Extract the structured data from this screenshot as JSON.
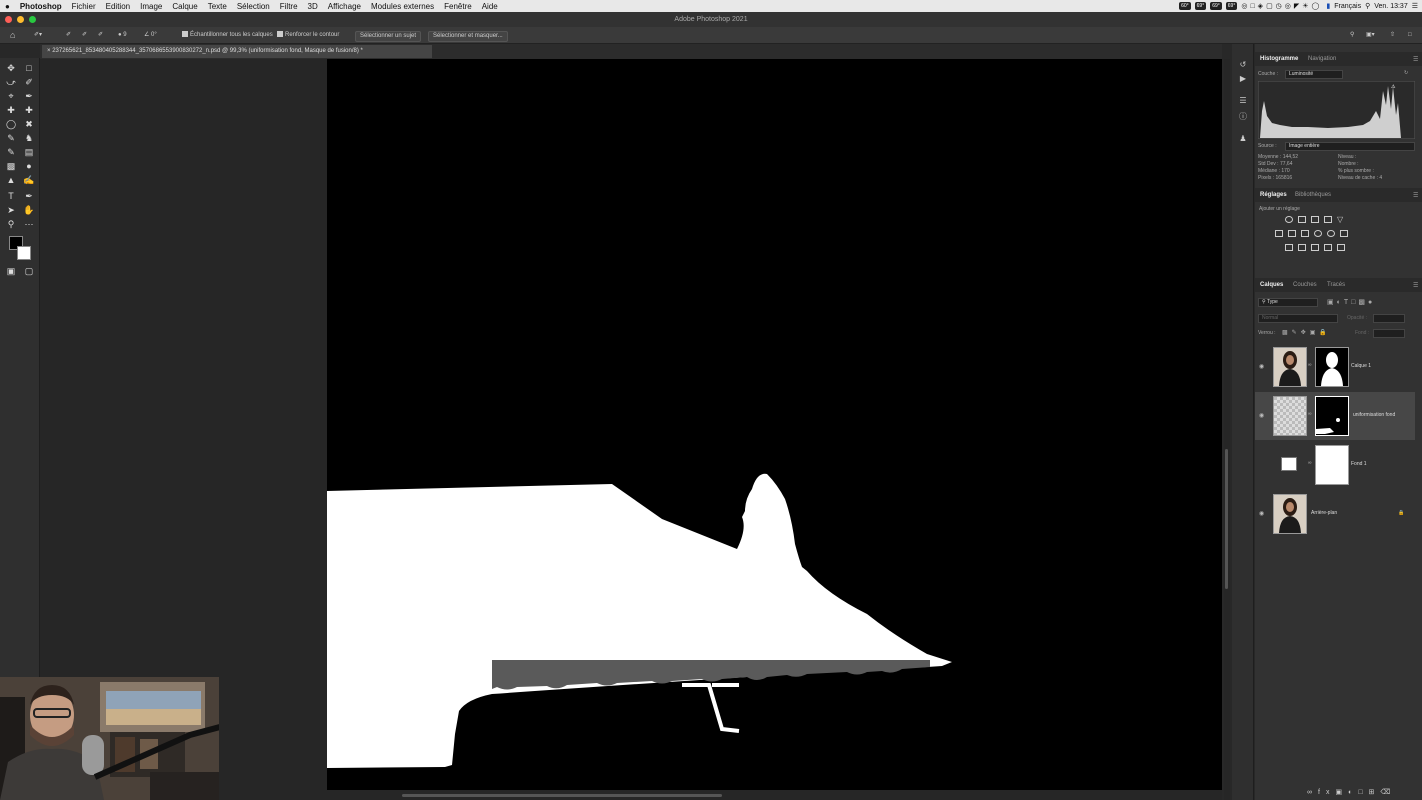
{
  "menubar": {
    "apple": "",
    "items": [
      "Photoshop",
      "Fichier",
      "Edition",
      "Image",
      "Calque",
      "Texte",
      "Sélection",
      "Filtre",
      "3D",
      "Affichage",
      "Modules externes",
      "Fenêtre",
      "Aide"
    ],
    "tray": [
      "60°",
      "69°",
      "69°",
      "69°"
    ],
    "language": "Français",
    "clock": "Ven. 13:37"
  },
  "window": {
    "title": "Adobe Photoshop 2021"
  },
  "options": {
    "brush_size": "9",
    "angle": "0°",
    "sample_all_layers": "Échantillonner tous les calques",
    "enhance_edge": "Renforcer le contour",
    "select_subject": "Sélectionner un sujet",
    "select_and_mask": "Sélectionner et masquer..."
  },
  "document": {
    "tab_close": "×",
    "tab_label": "237265621_853480405288344_3570686553900830272_n.psd @ 99,3% (uniformisation fond, Masque de fusion/8) *"
  },
  "histogram_panel": {
    "tabs": [
      "Histogramme",
      "Navigation"
    ],
    "channel_label": "Couche :",
    "channel_value": "Luminosité",
    "source_label": "Source :",
    "source_value": "Image entière",
    "stats_left": [
      {
        "label": "Moyenne :",
        "value": "144,52"
      },
      {
        "label": "Std Dev :",
        "value": "77,64"
      },
      {
        "label": "Médiane :",
        "value": "170"
      },
      {
        "label": "Pixels :",
        "value": "165816"
      }
    ],
    "stats_right": [
      {
        "label": "Niveau :",
        "value": ""
      },
      {
        "label": "Nombre :",
        "value": ""
      },
      {
        "label": "% plus sombre :",
        "value": ""
      },
      {
        "label": "Niveau de cache :",
        "value": "4"
      }
    ]
  },
  "adjustments_panel": {
    "tabs": [
      "Réglages",
      "Bibliothèques"
    ],
    "hint": "Ajouter un réglage"
  },
  "layers_panel": {
    "tabs": [
      "Calques",
      "Couches",
      "Tracés"
    ],
    "filter_value": "Type",
    "blend_mode": "Normal",
    "opacity_label": "Opacité :",
    "lock_label": "Verrou :",
    "fill_label": "Fond :",
    "layers": [
      {
        "name": "Calque 1",
        "visible": true,
        "selected": false
      },
      {
        "name": "uniformisation fond",
        "visible": true,
        "selected": true
      },
      {
        "name": "Fond 1",
        "visible": false,
        "selected": false
      },
      {
        "name": "Arrière-plan",
        "visible": true,
        "selected": false
      }
    ]
  },
  "colors": {
    "menubar": "#e8e8e8",
    "panel_bg": "#323232",
    "canvas_bg": "#000000",
    "mask_white": "#ffffff",
    "mask_gray": "#5a5a5a"
  }
}
